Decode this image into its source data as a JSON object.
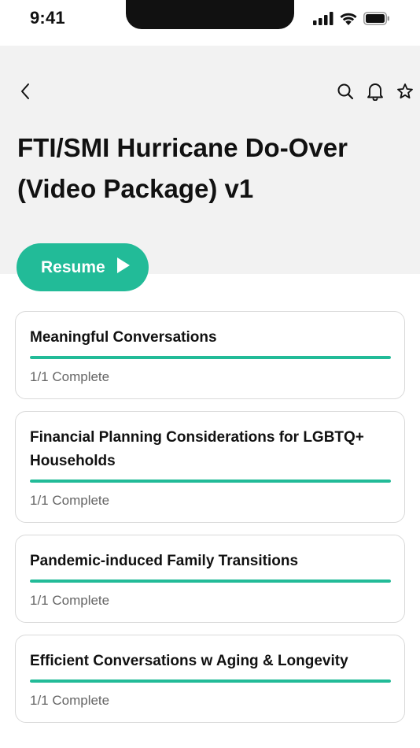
{
  "status_bar": {
    "time": "9:41"
  },
  "header": {
    "title": "FTI/SMI Hurricane Do-Over (Video Package) v1",
    "icons": [
      "chevron-left-icon",
      "search-icon",
      "bell-icon",
      "star-icon"
    ]
  },
  "resume": {
    "label": "Resume"
  },
  "colors": {
    "accent": "#22bb98",
    "header_bg": "#f2f2f2",
    "card_border": "#d9d9d9",
    "muted_text": "#666666"
  },
  "modules": [
    {
      "title": "Meaningful Conversations",
      "status": "1/1 Complete",
      "progress": 1.0
    },
    {
      "title": "Financial Planning Considerations for LGBTQ+ Households",
      "status": "1/1 Complete",
      "progress": 1.0
    },
    {
      "title": "Pandemic-induced Family Transitions",
      "status": "1/1 Complete",
      "progress": 1.0
    },
    {
      "title": "Efficient Conversations w Aging & Longevity",
      "status": "1/1 Complete",
      "progress": 1.0
    }
  ]
}
